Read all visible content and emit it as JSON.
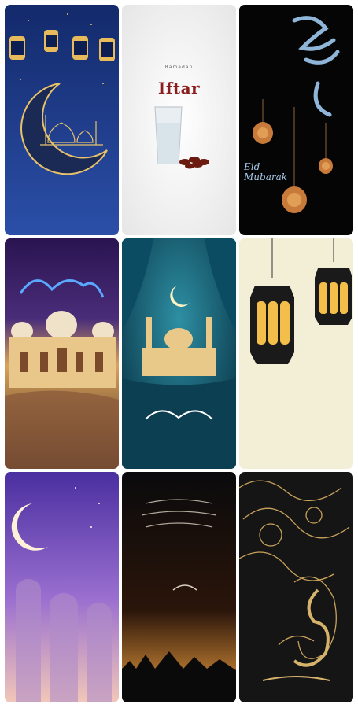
{
  "wallpapers": [
    {
      "id": "ramadan-crescent-mosque-blue"
    },
    {
      "id": "iftar-water-dates",
      "caption_top": "Ramadan",
      "caption": "Iftar"
    },
    {
      "id": "eid-mubarak-lanterns",
      "caption_en": "Eid\nMubarak"
    },
    {
      "id": "ramadan-kareem-mosque"
    },
    {
      "id": "ramadan-mubarak-mosque-curtains"
    },
    {
      "id": "hanging-lanterns-cream"
    },
    {
      "id": "crescent-purple-city"
    },
    {
      "id": "ramadan-kareem-dark-crescent"
    },
    {
      "id": "gold-ornament-ramadan"
    }
  ],
  "colors": {
    "accent_gold": "#d9b25c",
    "navy": "#1d3a8a",
    "iftar_red": "#8b1e1e"
  }
}
